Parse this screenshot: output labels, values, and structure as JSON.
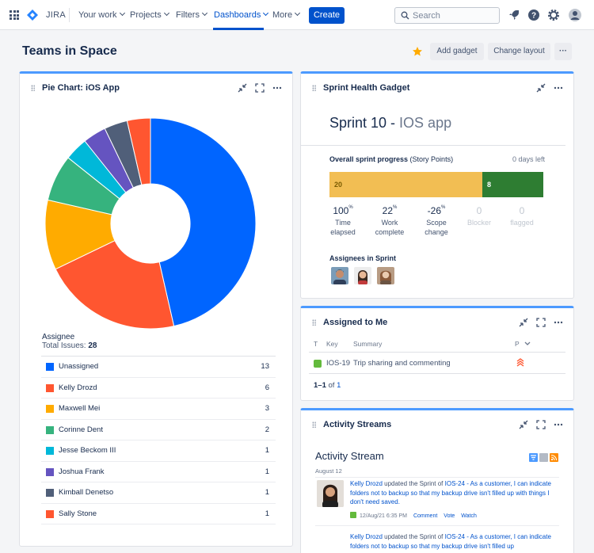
{
  "nav": {
    "brand": "JIRA",
    "items": [
      "Your work",
      "Projects",
      "Filters",
      "Dashboards",
      "More"
    ],
    "create_label": "Create",
    "search_placeholder": "Search"
  },
  "page": {
    "title": "Teams in Space",
    "add_gadget_label": "Add gadget",
    "change_layout_label": "Change layout",
    "more_label": "···"
  },
  "pie_gadget": {
    "title": "Pie Chart: iOS App",
    "assignee_label": "Assignee",
    "total_label": "Total Issues:",
    "total_value": "28"
  },
  "chart_data": {
    "type": "pie",
    "title": "Pie Chart: iOS App",
    "donut": true,
    "slices": [
      {
        "label": "Unassigned",
        "value": 13,
        "color": "#0065FF"
      },
      {
        "label": "Kelly Drozd",
        "value": 6,
        "color": "#FF5630"
      },
      {
        "label": "Maxwell Mei",
        "value": 3,
        "color": "#FFAB00"
      },
      {
        "label": "Corinne Dent",
        "value": 2,
        "color": "#36B37E"
      },
      {
        "label": "Jesse Beckom III",
        "value": 1,
        "color": "#00B8D9"
      },
      {
        "label": "Joshua Frank",
        "value": 1,
        "color": "#6554C0"
      },
      {
        "label": "Kimball Denetso",
        "value": 1,
        "color": "#505F79"
      },
      {
        "label": "Sally Stone",
        "value": 1,
        "color": "#FF5630"
      }
    ]
  },
  "sprint_gadget": {
    "title": "Sprint Health Gadget",
    "sprint_name": "Sprint 10 - ",
    "sprint_app": "IOS app",
    "progress_label_bold": "Overall sprint progress",
    "progress_label_rest": " (Story Points)",
    "days_left": "0 days left",
    "done_points": 20,
    "remaining_points": 8,
    "done_label": "20",
    "remaining_label": "8",
    "metrics": [
      {
        "value": "100",
        "unit": "%",
        "label": "Time elapsed",
        "dim": false
      },
      {
        "value": "22",
        "unit": "%",
        "label": "Work complete",
        "dim": false
      },
      {
        "value": "-26",
        "unit": "%",
        "label": "Scope change",
        "dim": false
      },
      {
        "value": "0",
        "unit": "",
        "label": "Blocker",
        "dim": true
      },
      {
        "value": "0",
        "unit": "",
        "label": "flagged",
        "dim": true
      }
    ],
    "assignees_label": "Assignees in Sprint"
  },
  "assigned_gadget": {
    "title": "Assigned to Me",
    "columns": {
      "t": "T",
      "key": "Key",
      "summary": "Summary",
      "p": "P"
    },
    "row": {
      "key": "IOS-19",
      "summary": "Trip sharing and commenting"
    },
    "pager_range": "1–1",
    "pager_of": " of ",
    "pager_total": "1"
  },
  "activity_gadget": {
    "title": "Activity Streams",
    "stream_title": "Activity Stream",
    "date": "August 12",
    "entries": [
      {
        "author": "Kelly Drozd",
        "action": " updated the Sprint of ",
        "issue": "IOS-24 - As a customer, I can indicate folders not to backup so that my backup drive isn't filled up with things I don't need saved.",
        "meta_time": "12/Aug/21 6:35 PM",
        "actions": [
          "Comment",
          "Vote",
          "Watch"
        ]
      },
      {
        "author": "Kelly Drozd",
        "action": " updated the Sprint of ",
        "issue": "IOS-24 - As a customer, I can indicate folders not to backup so that my backup drive isn't filled up"
      }
    ]
  }
}
